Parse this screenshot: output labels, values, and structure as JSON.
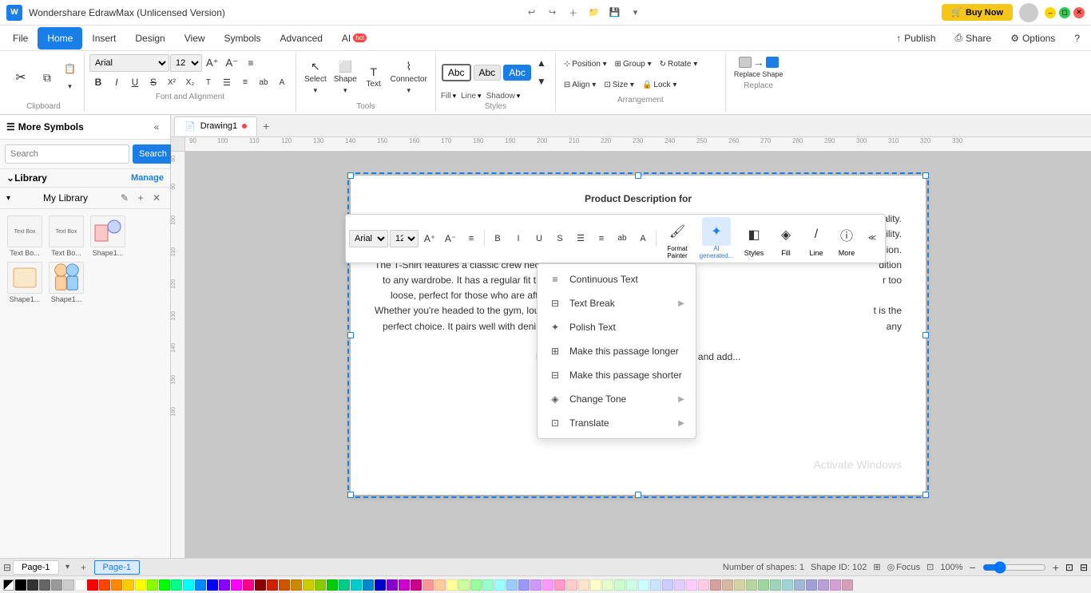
{
  "app": {
    "title": "Wondershare EdrawMax (Unlicensed Version)",
    "buy_now": "Buy Now"
  },
  "menu": {
    "items": [
      "File",
      "Home",
      "Insert",
      "Design",
      "View",
      "Symbols",
      "Advanced",
      "AI"
    ],
    "active": "Home",
    "ai_label": "AI",
    "right_items": [
      "Publish",
      "Share",
      "Options",
      "?"
    ]
  },
  "ribbon": {
    "clipboard_label": "Clipboard",
    "font_alignment_label": "Font and Alignment",
    "tools_label": "Tools",
    "styles_label": "Styles",
    "arrangement_label": "Arrangement",
    "replace_label": "Replace",
    "select_label": "Select",
    "shape_label": "Shape",
    "text_label": "Text",
    "connector_label": "Connector",
    "fill_label": "Fill",
    "line_label": "Line",
    "shadow_label": "Shadow",
    "position_label": "Position",
    "group_label": "Group",
    "rotate_label": "Rotate",
    "align_label": "Align",
    "size_label": "Size",
    "lock_label": "Lock",
    "replace_shape_label": "Replace Shape",
    "font_name": "Arial",
    "font_size": "12"
  },
  "sidebar": {
    "title": "More Symbols",
    "search_placeholder": "Search",
    "search_btn": "Search",
    "library_label": "Library",
    "manage_label": "Manage",
    "my_library_label": "My Library",
    "thumbnails": [
      {
        "label": "Text Bo..."
      },
      {
        "label": "Text Bo..."
      },
      {
        "label": "Shape1..."
      },
      {
        "label": "Shape1..."
      },
      {
        "label": "Shape1..."
      }
    ]
  },
  "tabs": {
    "drawing_tab": "Drawing1",
    "add_tab": "+"
  },
  "canvas": {
    "content": "Product Description for\nThis stylish Red T-Shirt is perfect for any fashion-co... quality.\ncotton fabric, it not only feels soft and comfortable agai... ability.\nThe vibrant shade of red adds a pop of color to any ou... sion.\nThe T-Shirt features a classic crew neck design and s... dition\n  to any wardrobe. It has a regular fit that drapes nicely... r too\n    loose, perfect for those who are after a...\nWhether you're headed to the gym, lounging with friend... t is the\n  perfect choice. It pairs well with denim jeans, shorts, ... any\n                        day of the wee...\n        Invest in this stylish Red T-Shirt today and add..."
  },
  "floating_toolbar": {
    "font_name": "Arial",
    "font_size": "12",
    "format_painter": "Format Painter",
    "ai_generated": "AI generated...",
    "styles": "Styles",
    "fill": "Fill",
    "line": "Line",
    "more": "More"
  },
  "context_menu": {
    "items": [
      {
        "label": "Continuous Text",
        "has_arrow": false
      },
      {
        "label": "Text Break",
        "has_arrow": true
      },
      {
        "label": "Polish Text",
        "has_arrow": false
      },
      {
        "label": "Make this passage longer",
        "has_arrow": false
      },
      {
        "label": "Make this passage shorter",
        "has_arrow": false
      },
      {
        "label": "Change Tone",
        "has_arrow": true
      },
      {
        "label": "Translate",
        "has_arrow": true
      }
    ]
  },
  "status_bar": {
    "page_label": "Page-1",
    "add_page": "+",
    "page_tab": "Page-1",
    "shapes_count": "Number of shapes: 1",
    "shape_id": "Shape ID: 102",
    "focus": "Focus",
    "zoom": "100%"
  },
  "colors": [
    "#000000",
    "#333333",
    "#666666",
    "#999999",
    "#cccccc",
    "#ffffff",
    "#ff0000",
    "#ff4400",
    "#ff8800",
    "#ffcc00",
    "#ffff00",
    "#88ff00",
    "#00ff00",
    "#00ff88",
    "#00ffff",
    "#0088ff",
    "#0000ff",
    "#8800ff",
    "#ff00ff",
    "#ff0088",
    "#8B0000",
    "#cc2200",
    "#cc5500",
    "#cc8800",
    "#cccc00",
    "#88cc00",
    "#00cc00",
    "#00cc88",
    "#00cccc",
    "#0088cc",
    "#0000cc",
    "#8800cc",
    "#cc00cc",
    "#cc0088",
    "#ff9999",
    "#ffcc99",
    "#ffff99",
    "#ccff99",
    "#99ff99",
    "#99ffcc",
    "#99ffff",
    "#99ccff",
    "#9999ff",
    "#cc99ff",
    "#ff99ff",
    "#ff99cc",
    "#ffcccc",
    "#ffe5cc",
    "#ffffcc",
    "#e5ffcc",
    "#ccffcc",
    "#ccffe5",
    "#ccffff",
    "#cce5ff",
    "#ccccff",
    "#e5ccff",
    "#ffccff",
    "#ffcce5",
    "#d4a0a0",
    "#d4b8a0",
    "#d4d4a0",
    "#b8d4a0",
    "#a0d4a0",
    "#a0d4b8",
    "#a0d4d4",
    "#a0b8d4",
    "#a0a0d4",
    "#b8a0d4",
    "#d4a0d4",
    "#d4a0b8"
  ],
  "accent_color": "#1a7ee8"
}
